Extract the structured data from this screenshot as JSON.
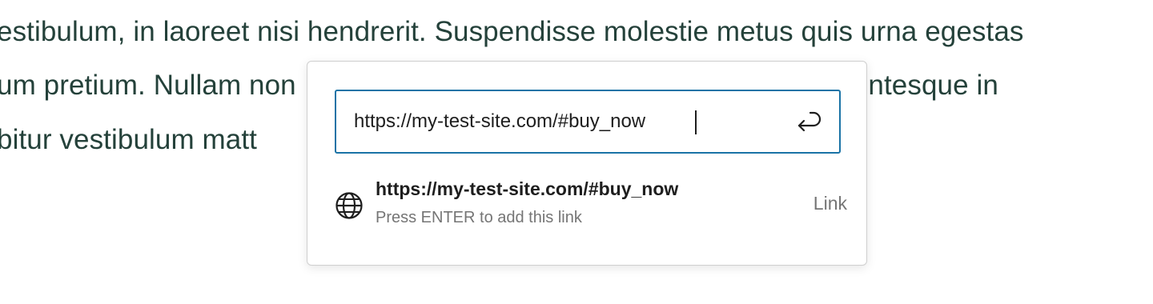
{
  "paragraph": {
    "line1": "estibulum, in laoreet nisi hendrerit. Suspendisse molestie metus quis urna egestas",
    "line2": "um pretium. Nullam non                                                         hus. Pellentesque in",
    "line3": "bitur vestibulum matt"
  },
  "link_popover": {
    "url_value": "https://my-test-site.com/#buy_now",
    "submit_icon": "enter-return-icon",
    "suggestion": {
      "icon": "globe-icon",
      "title": "https://my-test-site.com/#buy_now",
      "info": "Press ENTER to add this link",
      "type": "Link"
    }
  },
  "colors": {
    "body_text": "#24413a",
    "accent": "#1a73a6",
    "muted": "#757575"
  }
}
